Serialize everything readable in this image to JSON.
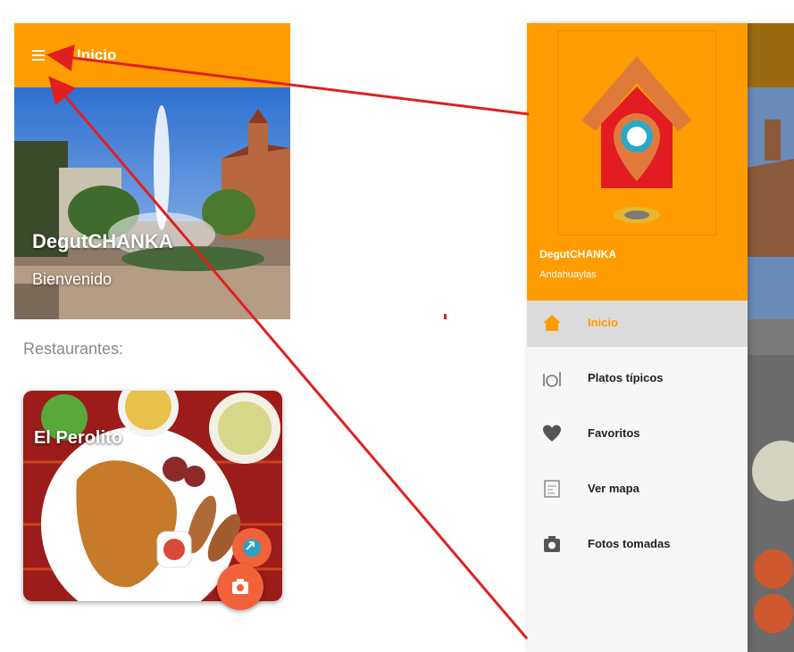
{
  "left_screen": {
    "appbar": {
      "title": "Inicio"
    },
    "hero": {
      "app_name": "DegutCHANKA",
      "welcome": "Bienvenido"
    },
    "section_heading": "Restaurantes:",
    "restaurant_card": {
      "name": "El Perolito"
    },
    "fabs": {
      "share_icon": "share-icon",
      "camera_icon": "camera-icon"
    }
  },
  "drawer": {
    "app_name": "DegutCHANKA",
    "location": "Andahuaylas",
    "logo_icon": "house-location-pin-logo",
    "items": [
      {
        "label": "Inicio",
        "icon": "home-icon",
        "selected": true
      },
      {
        "label": "Platos típicos",
        "icon": "dish-icon",
        "selected": false
      },
      {
        "label": "Favoritos",
        "icon": "heart-icon",
        "selected": false
      },
      {
        "label": "Ver mapa",
        "icon": "map-icon",
        "selected": false
      },
      {
        "label": "Fotos tomadas",
        "icon": "camera-icon",
        "selected": false
      }
    ]
  },
  "colors": {
    "primary": "#ff9c00",
    "accent": "#f2623a",
    "selected_row": "#dcdcdc",
    "annotation_arrow": "#e02020"
  }
}
